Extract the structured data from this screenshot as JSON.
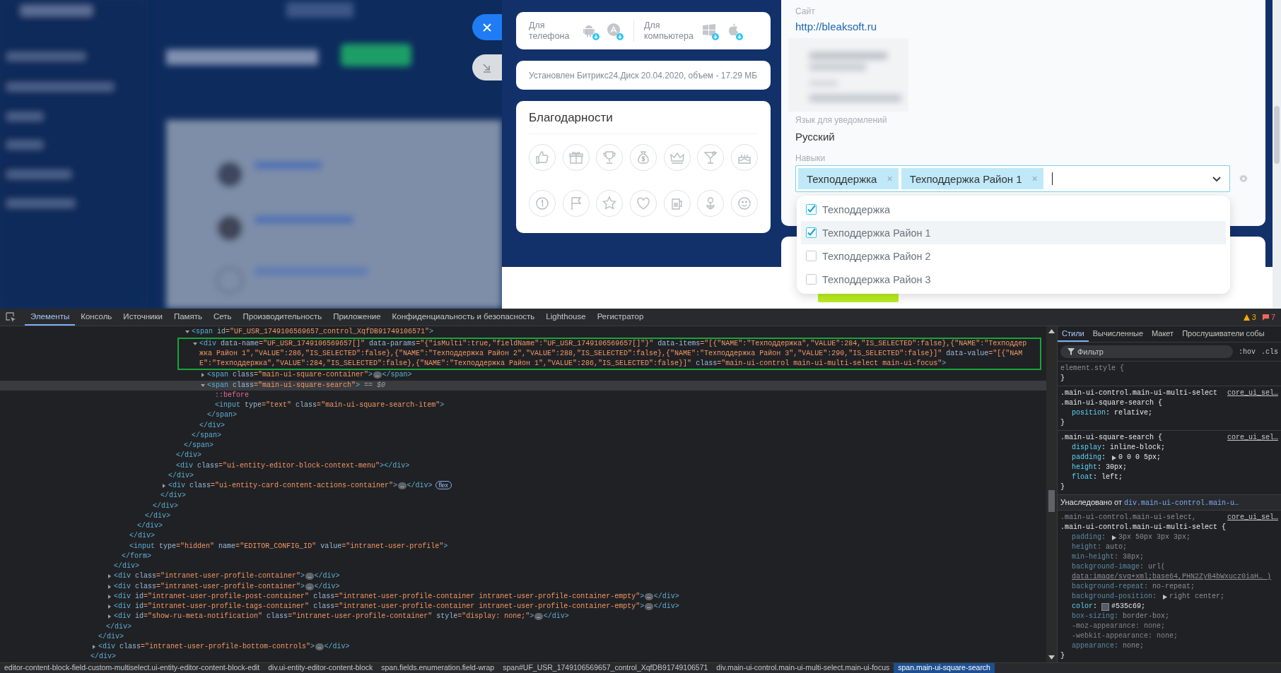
{
  "apps_card": {
    "phone_label": "Для телефона",
    "desktop_label": "Для компьютера"
  },
  "disk_info": "Установлен Битрикс24.Диск 20.04.2020, объем - 17.29 МБ",
  "thanks": {
    "title": "Благодарности"
  },
  "profile": {
    "fields": [
      {
        "kind": "link",
        "label": "Сайт",
        "value": "http://bleaksoft.ru"
      },
      {
        "kind": "blurred"
      },
      {
        "kind": "text",
        "label": "Язык для уведомлений",
        "value": "Русский"
      }
    ],
    "skills": {
      "label": "Навыки",
      "tags": [
        {
          "text": "Техподдержка",
          "remove": "×"
        },
        {
          "text": "Техподдержка Район 1",
          "remove": "×"
        }
      ],
      "options": [
        {
          "label": "Техподдержка",
          "checked": true,
          "selected": false
        },
        {
          "label": "Техподдержка Район 1",
          "checked": true,
          "selected": true
        },
        {
          "label": "Техподдержка Район 2",
          "checked": false,
          "selected": false
        },
        {
          "label": "Техподдержка Район 3",
          "checked": false,
          "selected": false
        }
      ]
    }
  },
  "devtools": {
    "tabs": [
      {
        "label": "Элементы",
        "selected": true
      },
      {
        "label": "Консоль",
        "selected": false
      },
      {
        "label": "Источники",
        "selected": false
      },
      {
        "label": "Память",
        "selected": false
      },
      {
        "label": "Сеть",
        "selected": false
      },
      {
        "label": "Производительность",
        "selected": false
      },
      {
        "label": "Приложение",
        "selected": false
      },
      {
        "label": "Конфиденциальность и безопасность",
        "selected": false
      },
      {
        "label": "Lighthouse",
        "selected": false
      },
      {
        "label": "Регистратор",
        "selected": false
      }
    ],
    "warnings": "3",
    "errors": "7",
    "dom_tree": [
      {
        "kind": "expanded",
        "selected": false,
        "close": "</div>",
        "children": [
          {
            "kind": "expanded",
            "selected": false,
            "close": "</div>",
            "children": [
              {
                "kind": "expanded",
                "selected": false,
                "close": "</div>",
                "children": [
                  {
                    "kind": "expanded",
                    "selected": false,
                    "close": "</div>",
                    "children": [
                      {
                        "kind": "expanded",
                        "selected": false,
                        "close": "</form>",
                        "children": [
                          {
                            "kind": "expanded",
                            "selected": false,
                            "close": "</div>",
                            "children": [
                              {
                                "kind": "expanded",
                                "selected": false,
                                "close": "</div>",
                                "children": [
                                  {
                                    "kind": "expanded",
                                    "selected": false,
                                    "close": "</div>",
                                    "children": [
                                      {
                                        "kind": "expanded",
                                        "selected": false,
                                        "close": "</div>",
                                        "children": [
                                          {
                                            "kind": "expanded",
                                            "selected": false,
                                            "close": "</div>",
                                            "children": [
                                              {
                                                "kind": "expanded",
                                                "selected": false,
                                                "close": "</div>",
                                                "children": [
                                                  {
                                                    "kind": "expanded",
                                                    "selected": false,
                                                    "close": "</div>",
                                                    "children": [
                                                      {
                                                        "kind": "expanded",
                                                        "selected": false,
                                                        "close": "</span>",
                                                        "children": [
                                                          {
                                                            "kind": "expanded",
                                                            "selected": false,
                                                            "open": "<span id=\"UF_USR_1749106569657_control_XqfDB91749106571\">",
                                                            "close": "</span>",
                                                            "children": [
                                                              {
                                                                "kind": "expanded",
                                                                "selected": false,
                                                                "framed": true,
                                                                "open": "<div data-name=\"UF_USR_1749106569657[]\" data-params=\"{\"isMulti\":true,\"fieldName\":\"UF_USR_1749106569657[]\"}\" data-items=\"[{\"NAME\":\"Техподдержка\",\"VALUE\":284,\"IS_SELECTED\":false},{\"NAME\":\"Техподдержка Район 1\",\"VALUE\":286,\"IS_SELECTED\":false},{\"NAME\":\"Техподдержка Район 2\",\"VALUE\":288,\"IS_SELECTED\":false},{\"NAME\":\"Техподдержка Район 3\",\"VALUE\":290,\"IS_SELECTED\":false}]\" data-value=\"[{\"NAME\":\"Техподдержка\",\"VALUE\":284,\"IS_SELECTED\":false},{\"NAME\":\"Техподдержка Район 1\",\"VALUE\":286,\"IS_SELECTED\":false}]\" class=\"main-ui-control main-ui-multi-select main-ui-focus\">",
                                                                "close": "</div>",
                                                                "children": [
                                                                  {
                                                                    "kind": "collapsed",
                                                                    "selected": false,
                                                                    "open": "<span class=\"main-ui-square-container\">",
                                                                    "ellipsis": "…",
                                                                    "close": "</span>"
                                                                  },
                                                                  {
                                                                    "kind": "expanded",
                                                                    "selected": true,
                                                                    "open": "<span class=\"main-ui-square-search\">",
                                                                    "marker": "== $0",
                                                                    "close": "</span>",
                                                                    "children": [
                                                                      {
                                                                        "kind": "pseudo",
                                                                        "selected": false,
                                                                        "text": "::before"
                                                                      },
                                                                      {
                                                                        "kind": "leaf",
                                                                        "selected": false,
                                                                        "text": "<input type=\"text\" class=\"main-ui-square-search-item\">"
                                                                      }
                                                                    ]
                                                                  }
                                                                ]
                                                              }
                                                            ]
                                                          }
                                                        ]
                                                      }
                                                    ]
                                                  },
                                                  {
                                                    "kind": "leaf",
                                                    "selected": false,
                                                    "text": "<div class=\"ui-entity-editor-block-context-menu\"></div>"
                                                  }
                                                ]
                                              },
                                              {
                                                "kind": "collapsed",
                                                "selected": false,
                                                "open": "<div class=\"ui-entity-card-content-actions-container\">",
                                                "ellipsis": "…",
                                                "close": "</div>",
                                                "badge": "flex"
                                              }
                                            ]
                                          }
                                        ]
                                      }
                                    ]
                                  }
                                ]
                              }
                            ]
                          },
                          {
                            "kind": "leaf",
                            "selected": false,
                            "text": "<input type=\"hidden\" name=\"EDITOR_CONFIG_ID\" value=\"intranet-user-profile\">"
                          }
                        ]
                      }
                    ]
                  },
                  {
                    "kind": "collapsed",
                    "selected": false,
                    "open": "<div class=\"intranet-user-profile-container\">",
                    "ellipsis": "…",
                    "close": "</div>"
                  },
                  {
                    "kind": "collapsed",
                    "selected": false,
                    "open": "<div class=\"intranet-user-profile-container\">",
                    "ellipsis": "…",
                    "close": "</div>"
                  },
                  {
                    "kind": "collapsed",
                    "selected": false,
                    "open": "<div id=\"intranet-user-profile-post-container\" class=\"intranet-user-profile-container intranet-user-profile-container-empty\">",
                    "ellipsis": "…",
                    "close": "</div>"
                  },
                  {
                    "kind": "collapsed",
                    "selected": false,
                    "open": "<div id=\"intranet-user-profile-tags-container\" class=\"intranet-user-profile-container intranet-user-profile-container-empty\">",
                    "ellipsis": "…",
                    "close": "</div>"
                  },
                  {
                    "kind": "collapsed",
                    "selected": false,
                    "open": "<div id=\"show-ru-meta-notification\" class=\"intranet-user-profile-container\" style=\"display: none;\">",
                    "ellipsis": "…",
                    "close": "</div>"
                  }
                ]
              }
            ]
          },
          {
            "kind": "collapsed",
            "selected": false,
            "open": "<div class=\"intranet-user-profile-bottom-controls\">",
            "ellipsis": "…",
            "close": "</div>"
          }
        ]
      }
    ],
    "breadcrumbs": [
      {
        "label": "editor-content-block-field-custom-multiselect.ui-entity-editor-content-block-edit",
        "selected": false
      },
      {
        "label": "div.ui-entity-editor-content-block",
        "selected": false
      },
      {
        "label": "span.fields.enumeration.field-wrap",
        "selected": false
      },
      {
        "label": "span#UF_USR_1749106569657_control_XqfDB91749106571",
        "selected": false
      },
      {
        "label": "div.main-ui-control.main-ui-multi-select.main-ui-focus",
        "selected": false
      },
      {
        "label": "span.main-ui-square-search",
        "selected": true
      }
    ],
    "styles": {
      "tabs": [
        {
          "label": "Стили",
          "selected": true
        },
        {
          "label": "Вычисленные",
          "selected": false
        },
        {
          "label": "Макет",
          "selected": false
        },
        {
          "label": "Прослушиватели собы",
          "selected": false
        }
      ],
      "filter_placeholder": "Фильтр",
      "toggles": [
        ":hov",
        ".cls"
      ],
      "rules": [
        {
          "kind": "rule",
          "selectors": [
            {
              "text": "element.style {",
              "matched": false
            }
          ],
          "close": "}"
        },
        {
          "kind": "rule",
          "source": "core_ui_sel…",
          "selectors": [
            {
              "text": ".main-ui-control.main-ui-multi-select",
              "matched": true
            },
            {
              "text": ".main-ui-square-search {",
              "matched": true
            }
          ],
          "close": "}",
          "declarations": [
            {
              "kind": "plain",
              "text": "position: relative;",
              "active": true,
              "struck": false,
              "expandable": false
            }
          ]
        },
        {
          "kind": "rule",
          "source": "core_ui_sel…",
          "selectors": [
            {
              "text": ".main-ui-square-search {",
              "matched": true
            }
          ],
          "close": "}",
          "declarations": [
            {
              "kind": "plain",
              "text": "display: inline-block;",
              "active": true,
              "struck": false,
              "expandable": false
            },
            {
              "kind": "plain",
              "text": "padding: 0 0 0 5px;",
              "active": true,
              "struck": false,
              "expandable": true
            },
            {
              "kind": "plain",
              "text": "height: 30px;",
              "active": true,
              "struck": false,
              "expandable": false
            },
            {
              "kind": "plain",
              "text": "float: left;",
              "active": true,
              "struck": false,
              "expandable": false
            }
          ]
        },
        {
          "kind": "inherited",
          "label": "Унаследовано от",
          "link": "div.main-ui-control.main-u…"
        },
        {
          "kind": "rule",
          "source": "core_ui_sel…",
          "selectors": [
            {
              "text": ".main-ui-control.main-ui-select,",
              "matched": false
            },
            {
              "text": ".main-ui-control.main-ui-multi-select {",
              "matched": true
            }
          ],
          "close": "}",
          "declarations": [
            {
              "kind": "plain",
              "text": "padding: 3px 50px 3px 3px;",
              "active": false,
              "struck": false,
              "expandable": true
            },
            {
              "kind": "plain",
              "text": "height: auto;",
              "active": false,
              "struck": false,
              "expandable": false
            },
            {
              "kind": "plain",
              "text": "min-height: 38px;",
              "active": false,
              "struck": false,
              "expandable": false
            },
            {
              "kind": "plain",
              "text": "background-image: url(",
              "link": "data:image/svg+xml;base64,PHN2ZyB4bWxucz0iaH…",
              "suffix": ")",
              "active": false,
              "struck": false,
              "expandable": false
            },
            {
              "kind": "plain",
              "text": "background-repeat: no-repeat;",
              "active": false,
              "struck": false,
              "expandable": false
            },
            {
              "kind": "plain",
              "text": "background-position: right center;",
              "active": false,
              "struck": false,
              "expandable": true
            },
            {
              "kind": "color",
              "text": "color: #535c69;",
              "active": true,
              "struck": false,
              "expandable": false
            },
            {
              "kind": "plain",
              "text": "box-sizing: border-box;",
              "active": false,
              "struck": false,
              "expandable": false
            },
            {
              "kind": "plain",
              "text": "-moz-appearance: none;",
              "active": false,
              "struck": true,
              "expandable": false
            },
            {
              "kind": "plain",
              "text": "-webkit-appearance: none;",
              "active": false,
              "struck": true,
              "expandable": false
            },
            {
              "kind": "plain",
              "text": "appearance: none;",
              "active": false,
              "struck": false,
              "expandable": false
            }
          ]
        }
      ]
    }
  }
}
